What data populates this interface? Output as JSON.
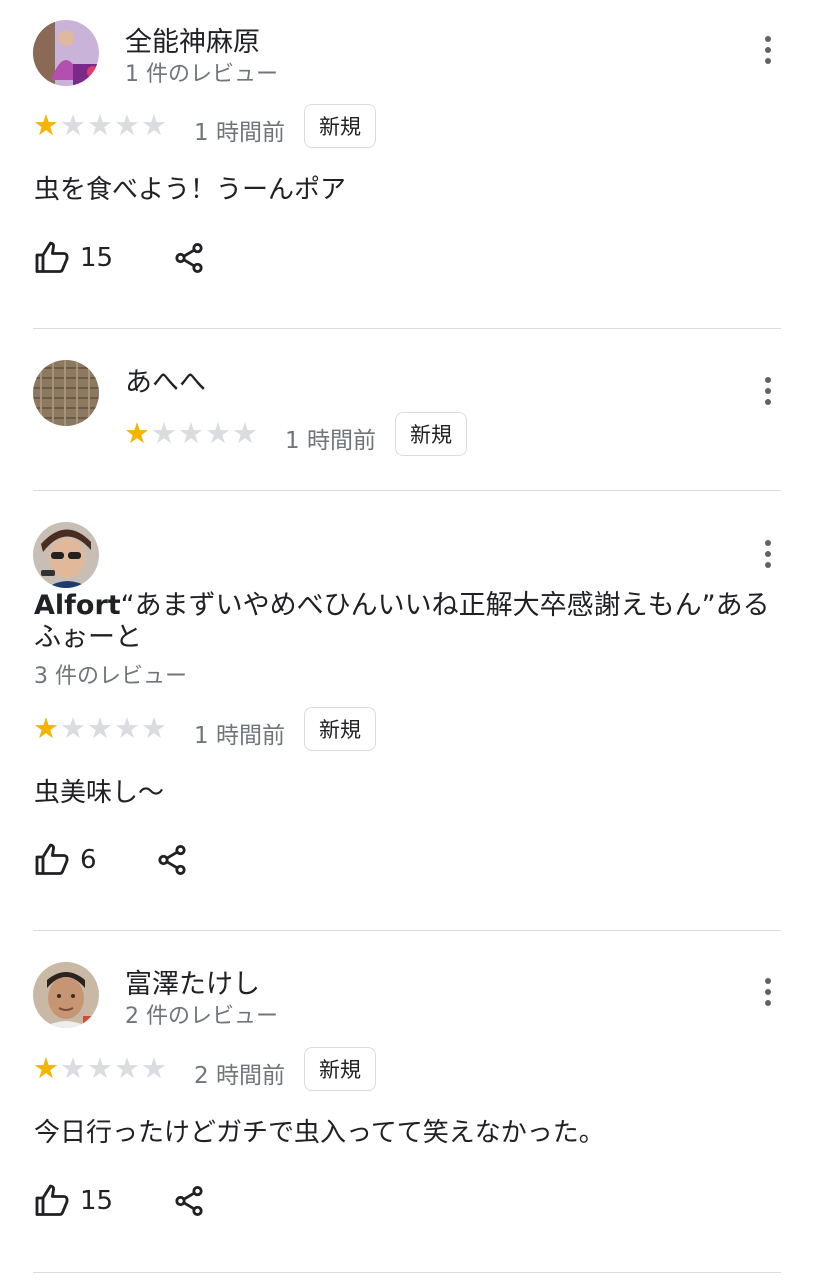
{
  "reviews": [
    {
      "name": "全能神麻原",
      "count_text": "1 件のレビュー",
      "stars": 1,
      "time": "1 時間前",
      "badge": "新規",
      "text": "虫を食べよう！うーんポア",
      "likes": "15"
    },
    {
      "name": "あへへ",
      "stars": 1,
      "time": "1 時間前",
      "badge": "新規"
    },
    {
      "name_part1": "Alfort",
      "name_part2": "“あまずいやめべひんいいね正解大卒感謝えもん”あるふぉーと",
      "count_text": "3 件のレビュー",
      "stars": 1,
      "time": "1 時間前",
      "badge": "新規",
      "text": "虫美味し〜",
      "likes": "6"
    },
    {
      "name": "富澤たけし",
      "count_text": "2 件のレビュー",
      "stars": 1,
      "time": "2 時間前",
      "badge": "新規",
      "text": "今日行ったけどガチで虫入ってて笑えなかった。",
      "likes": "15"
    }
  ],
  "colors": {
    "star_on": "#f4b400",
    "star_off": "#dadce0",
    "secondary_text": "#70757a",
    "divider": "#dadce0"
  },
  "icons": [
    "more-vert-icon",
    "thumb-up-icon",
    "share-icon",
    "star-icon"
  ]
}
